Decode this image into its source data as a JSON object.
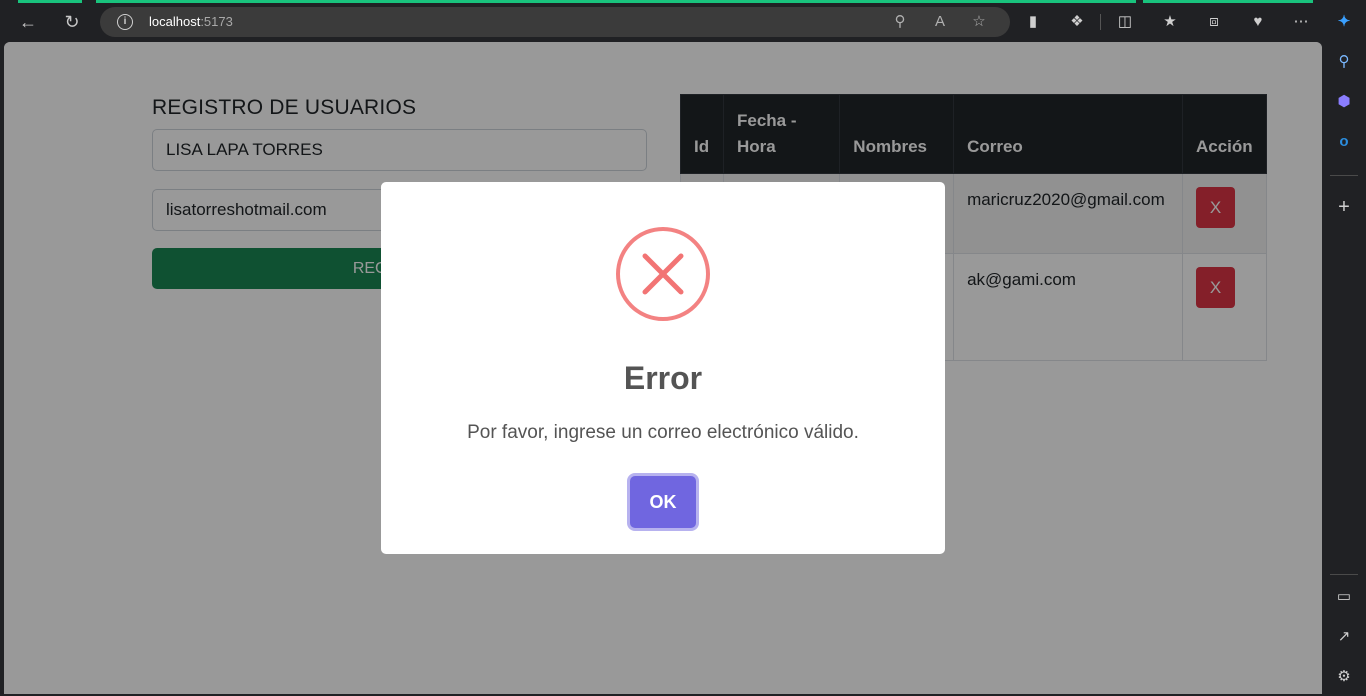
{
  "browser": {
    "url_host": "localhost",
    "url_port": ":5173"
  },
  "form": {
    "title": "REGISTRO DE USUARIOS",
    "name_value": "LISA LAPA TORRES",
    "email_value": "lisatorreshotmail.com",
    "submit_label": "REGISTRAR"
  },
  "table": {
    "headers": {
      "id": "Id",
      "fecha": "Fecha - Hora",
      "nombres": "Nombres",
      "correo": "Correo",
      "accion": "Acción"
    },
    "rows": [
      {
        "correo": "maricruz2020@gmail.com",
        "action_label": "X"
      },
      {
        "correo": "ak@gami.com",
        "action_label": "X"
      }
    ]
  },
  "modal": {
    "title": "Error",
    "message": "Por favor, ingrese un correo electrónico válido.",
    "ok_label": "OK",
    "icon": "error-x-icon"
  },
  "colors": {
    "success": "#198754",
    "danger": "#dc3545",
    "table_header": "#212529",
    "modal_confirm": "#7066e0",
    "error_icon": "#f27474"
  }
}
